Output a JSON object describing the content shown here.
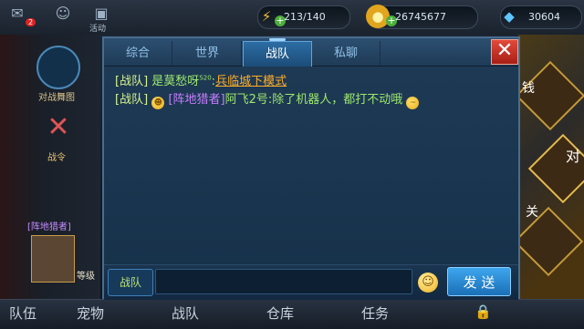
{
  "topbar": {
    "mail_badge": "2",
    "activity_label": "活动",
    "energy": "213/140",
    "gold": "26745677",
    "diamonds": "30604"
  },
  "background": {
    "map_label": "对战舞图",
    "rank_label": "战令",
    "player_guild": "[阵地猎者]",
    "level_label": "等级",
    "side_label_1": "钱",
    "side_label_2": "对",
    "side_label_3": "关"
  },
  "chat": {
    "tabs": [
      "综合",
      "世界",
      "战队",
      "私聊"
    ],
    "active_tab": "战队",
    "messages": [
      {
        "channel": "[战队]",
        "name": "是莫愁呀",
        "sup": "S20",
        "text": "兵临城下模式"
      },
      {
        "channel": "[战队]",
        "guild": "[阵地猎者]",
        "name": "阿飞2号",
        "text": "除了机器人，都打不动哦"
      }
    ],
    "input_channel": "战队",
    "input_value": "",
    "send_label": "发 送"
  },
  "bottom_tabs": [
    "队伍",
    "宠物",
    "战队",
    "仓库",
    "任务"
  ]
}
